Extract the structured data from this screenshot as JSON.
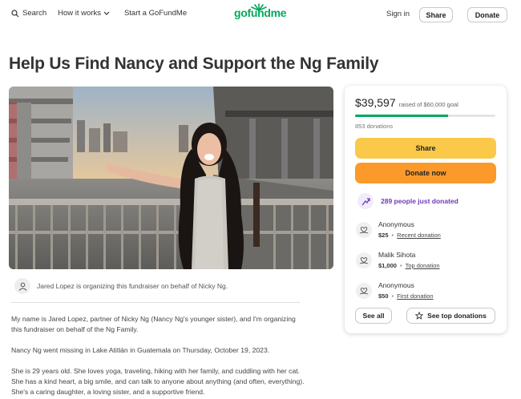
{
  "header": {
    "search_label": "Search",
    "how_it_works_label": "How it works",
    "start_label": "Start a GoFundMe",
    "logo_text": "gofundme",
    "signin_label": "Sign in",
    "share_label": "Share",
    "donate_label": "Donate"
  },
  "page": {
    "title": "Help Us Find Nancy and Support the Ng Family",
    "organizer_text": "Jared Lopez is organizing this fundraiser on behalf of Nicky Ng."
  },
  "story": {
    "paragraphs": [
      "My name is Jared Lopez, partner of Nicky Ng (Nancy Ng's younger sister), and I'm organizing this fundraiser on behalf of the Ng Family.",
      "Nancy Ng went missing in Lake Atitlán in Guatemala on Thursday, October 19, 2023.",
      "She is 29 years old. She loves yoga, traveling, hiking with her family, and cuddling with her cat. She has a kind heart, a big smile, and can talk to anyone about anything (and often, everything). She's a caring daughter, a loving sister, and a supportive friend."
    ]
  },
  "card": {
    "raised_amount": "$39,597",
    "goal_text": "raised of $60,000 goal",
    "progress_fraction": 0.66,
    "donation_count": "853 donations",
    "share_label": "Share",
    "donate_now_label": "Donate now",
    "trend_text": "289 people just donated",
    "donations": [
      {
        "name": "Anonymous",
        "amount": "$25",
        "tag": "Recent donation"
      },
      {
        "name": "Malik Sihota",
        "amount": "$1,000",
        "tag": "Top donation"
      },
      {
        "name": "Anonymous",
        "amount": "$50",
        "tag": "First donation"
      }
    ],
    "see_all_label": "See all",
    "see_top_label": "See top donations"
  },
  "colors": {
    "brand_green": "#02a95c",
    "share_yellow": "#fbc94a",
    "donate_orange": "#fb9a2a",
    "trend_purple": "#6d3bb6"
  },
  "icons": [
    "search-icon",
    "chevron-down-icon",
    "user-icon",
    "trend-up-icon",
    "hands-heart-icon",
    "star-icon"
  ]
}
